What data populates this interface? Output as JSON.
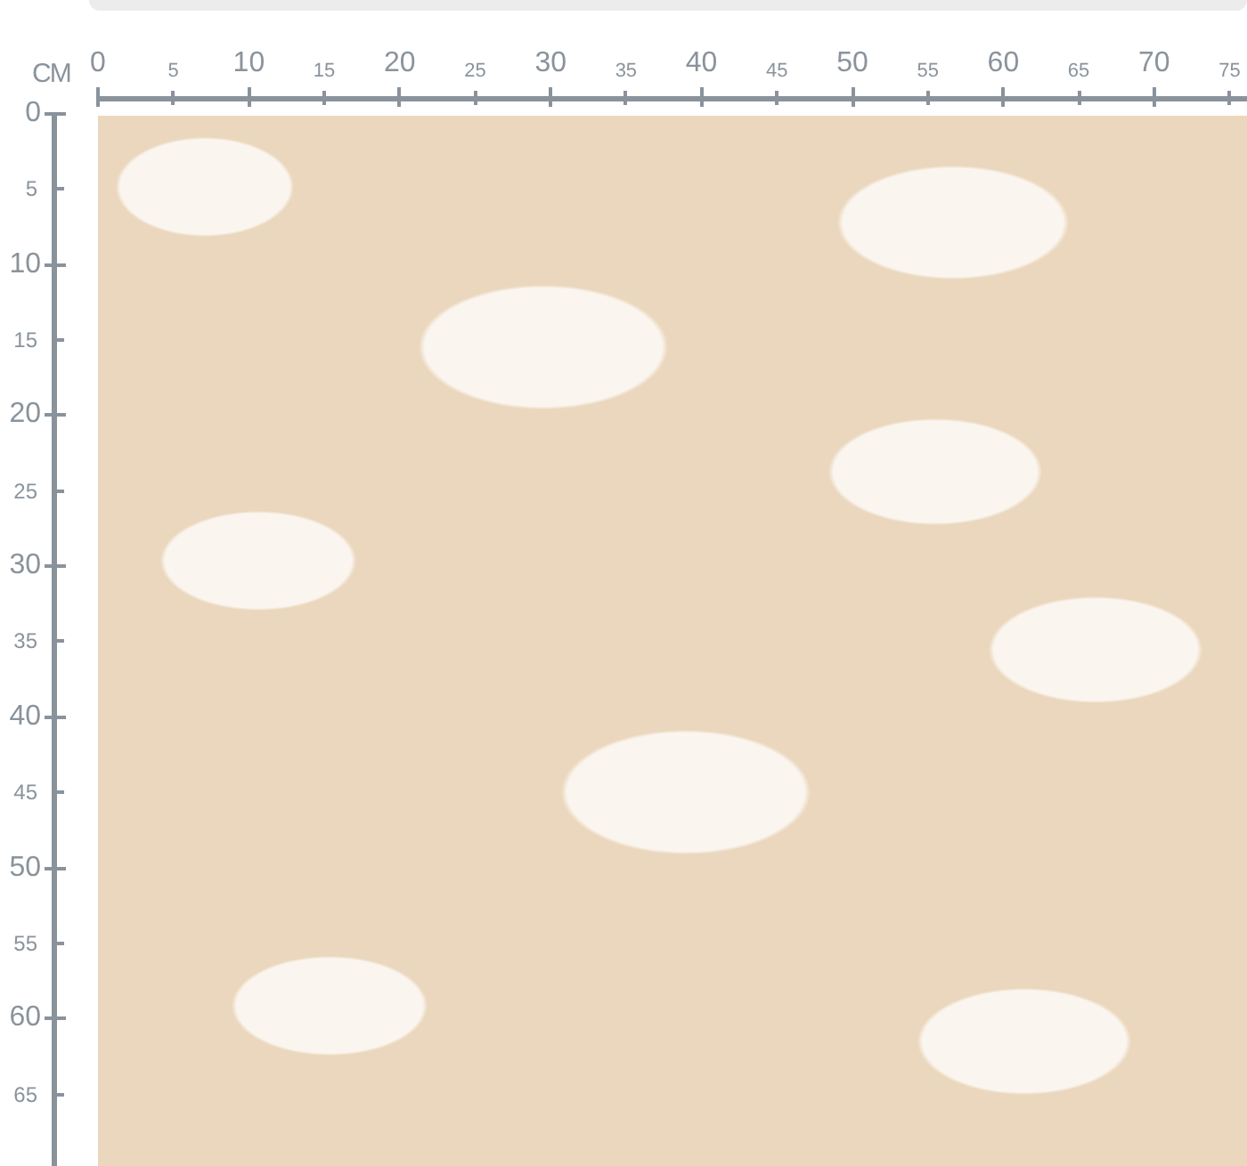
{
  "unit_label": "CM",
  "horizontal_ruler": {
    "labels": [
      "0",
      "5",
      "10",
      "15",
      "20",
      "25",
      "30",
      "35",
      "40",
      "45",
      "50",
      "55",
      "60",
      "65",
      "70",
      "75"
    ]
  },
  "vertical_ruler": {
    "labels": [
      "0",
      "5",
      "10",
      "15",
      "20",
      "25",
      "30",
      "35",
      "40",
      "45",
      "50",
      "55",
      "60",
      "65"
    ]
  }
}
